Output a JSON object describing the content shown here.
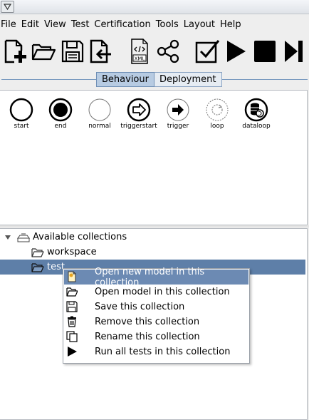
{
  "menubar": {
    "items": [
      "File",
      "Edit",
      "View",
      "Test",
      "Certification",
      "Tools",
      "Layout",
      "Help"
    ]
  },
  "toolbar": {
    "xml_label": "XML"
  },
  "tabs": {
    "items": [
      {
        "label": "Behaviour",
        "active": true
      },
      {
        "label": "Deployment",
        "active": false
      }
    ]
  },
  "palette": {
    "nodes": [
      {
        "label": "start",
        "icon": "start-node-icon"
      },
      {
        "label": "end",
        "icon": "end-node-icon"
      },
      {
        "label": "normal",
        "icon": "normal-node-icon"
      },
      {
        "label": "triggerstart",
        "icon": "trigger-start-node-icon"
      },
      {
        "label": "trigger",
        "icon": "trigger-node-icon"
      },
      {
        "label": "loop",
        "icon": "loop-node-icon"
      },
      {
        "label": "dataloop",
        "icon": "dataloop-node-icon"
      }
    ]
  },
  "tree": {
    "root": "Available collections",
    "children": [
      "workspace",
      "test"
    ],
    "selected": "test"
  },
  "context_menu": {
    "items": [
      {
        "label": "Open new model in this collection",
        "icon": "new-model-icon",
        "highlighted": true
      },
      {
        "label": "Open model in this collection",
        "icon": "folder-open-icon",
        "highlighted": false
      },
      {
        "label": "Save this collection",
        "icon": "save-icon",
        "highlighted": false
      },
      {
        "label": "Remove this collection",
        "icon": "trash-icon",
        "highlighted": false
      },
      {
        "label": "Rename this collection",
        "icon": "rename-icon",
        "highlighted": false
      },
      {
        "label": "Run all tests in this collection",
        "icon": "play-icon",
        "highlighted": false
      }
    ]
  },
  "colors": {
    "selection": "#5e7fa8",
    "menu_highlight": "#6c8ab3",
    "active_tab": "#b7cbe2"
  }
}
